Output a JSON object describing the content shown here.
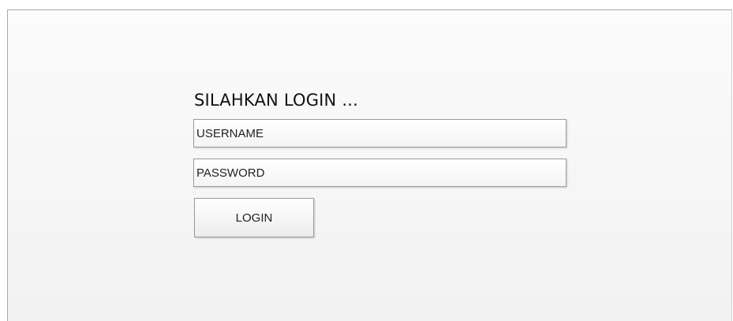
{
  "login": {
    "title": "SILAHKAN LOGIN ...",
    "username_placeholder": "USERNAME",
    "password_placeholder": "PASSWORD",
    "button_label": "LOGIN"
  }
}
